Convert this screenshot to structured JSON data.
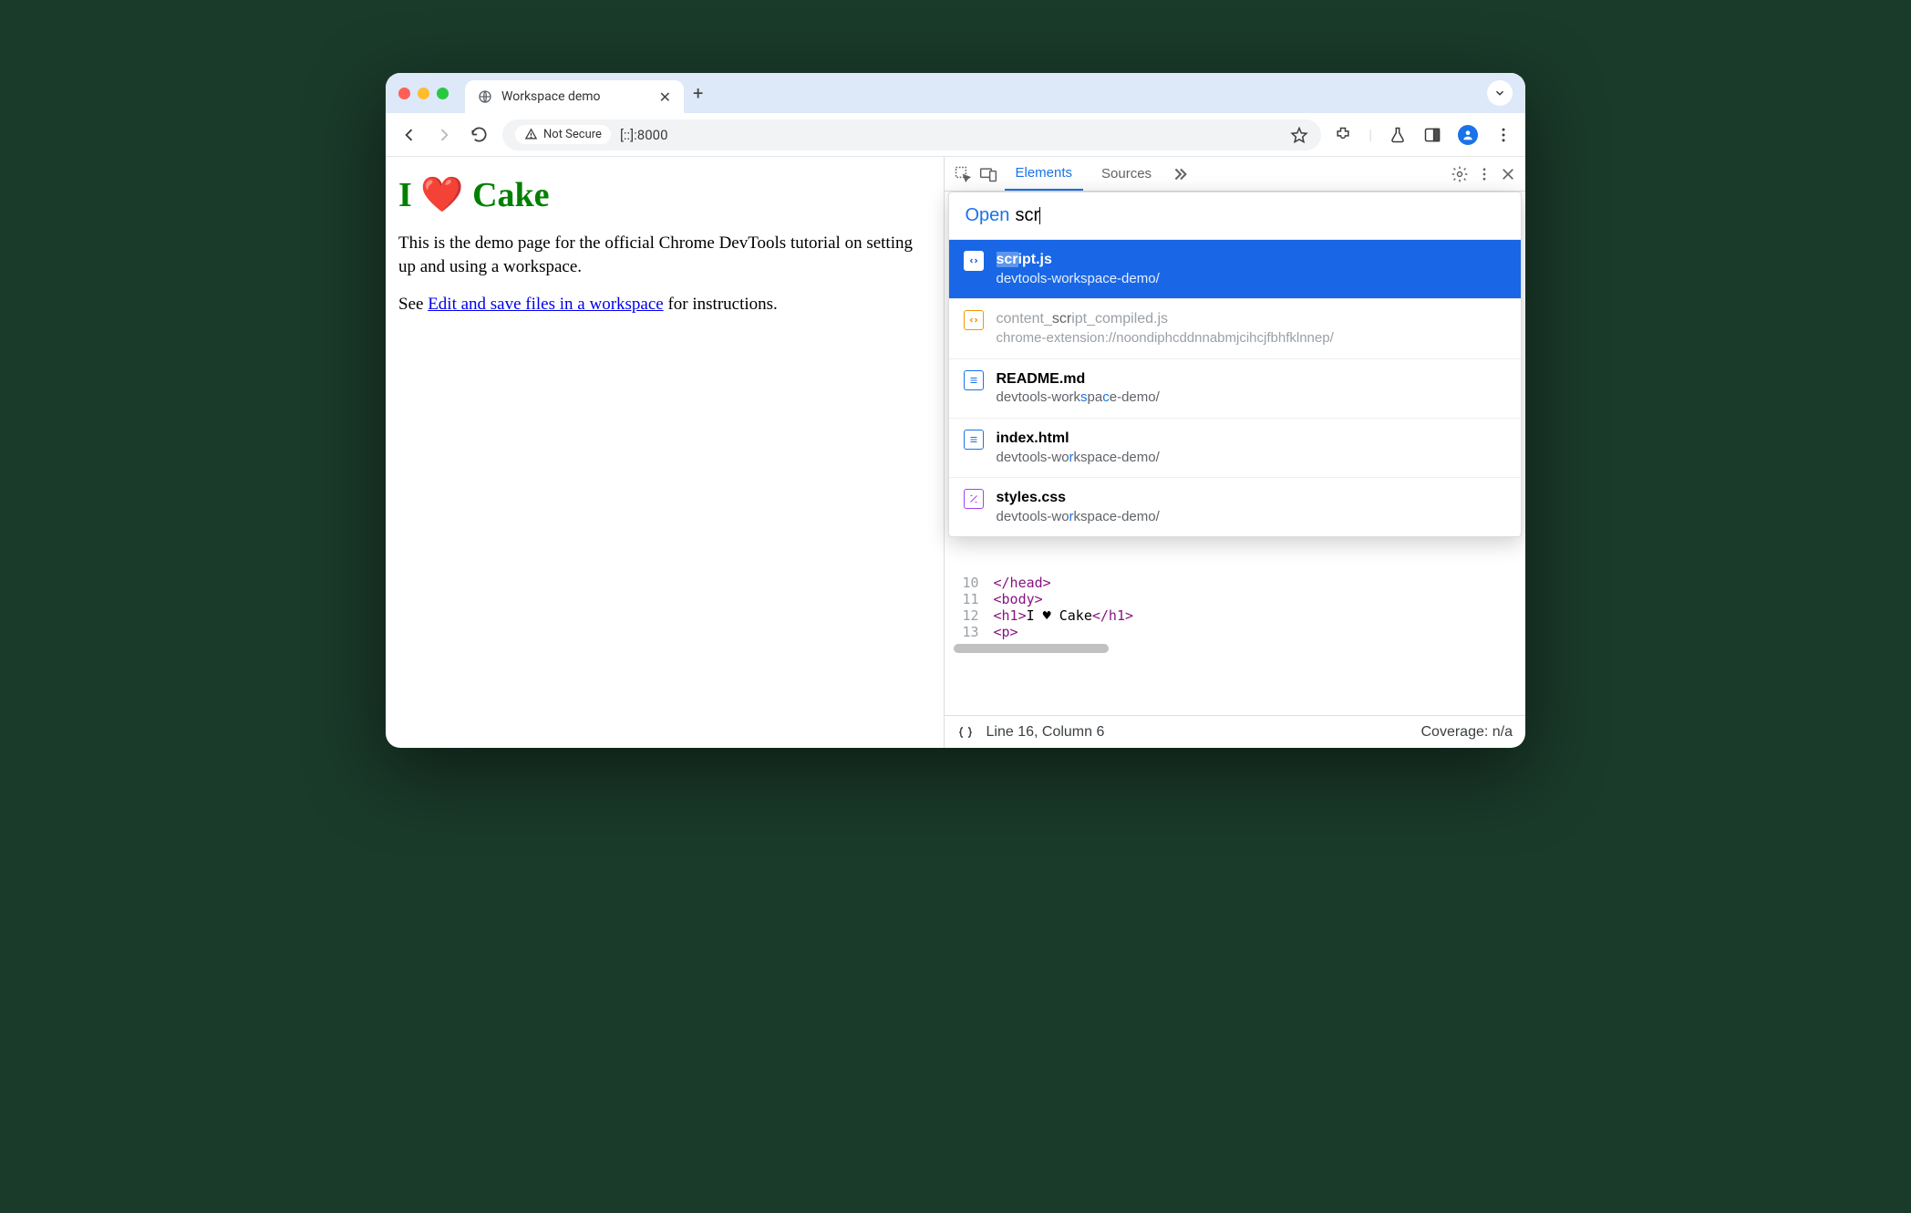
{
  "browser": {
    "tab_title": "Workspace demo",
    "security_chip": "Not Secure",
    "url": "[::]:8000"
  },
  "page": {
    "heading": "I ❤️ Cake",
    "paragraph": "This is the demo page for the official Chrome DevTools tutorial on setting up and using a workspace.",
    "see_prefix": "See ",
    "link_text": "Edit and save files in a workspace",
    "see_suffix": " for instructions."
  },
  "devtools": {
    "tabs": {
      "elements": "Elements",
      "sources": "Sources"
    },
    "open_dialog": {
      "prefix": "Open",
      "query": "scr",
      "results": [
        {
          "title_pre": "scr",
          "title_post": "ipt.js",
          "sub": "devtools-workspace-demo/",
          "icon": "script",
          "selected": true
        },
        {
          "title_pre": "content_",
          "title_mid": "scr",
          "title_post": "ipt_compiled.js",
          "sub": "chrome-extension://noondiphcddnnabmjcihcjfbhfklnnep/",
          "icon": "ext",
          "dim": true
        },
        {
          "title": "README.md",
          "sub": "devtools-workspace-demo/",
          "icon": "doc",
          "hl_chars": "s c"
        },
        {
          "title": "index.html",
          "sub": "devtools-workspace-demo/",
          "icon": "doc",
          "hl_chars": "r"
        },
        {
          "title": "styles.css",
          "sub": "devtools-workspace-demo/",
          "icon": "style",
          "hl_chars": "r"
        }
      ]
    },
    "code": {
      "lines": [
        {
          "n": "10",
          "html": "</head>"
        },
        {
          "n": "11",
          "html": "<body>"
        },
        {
          "n": "12",
          "html": "  <h1>I ♥ Cake</h1>"
        },
        {
          "n": "13",
          "html": "    <p>"
        }
      ]
    },
    "status": {
      "cursor": "Line 16, Column 6",
      "coverage": "Coverage: n/a"
    }
  }
}
